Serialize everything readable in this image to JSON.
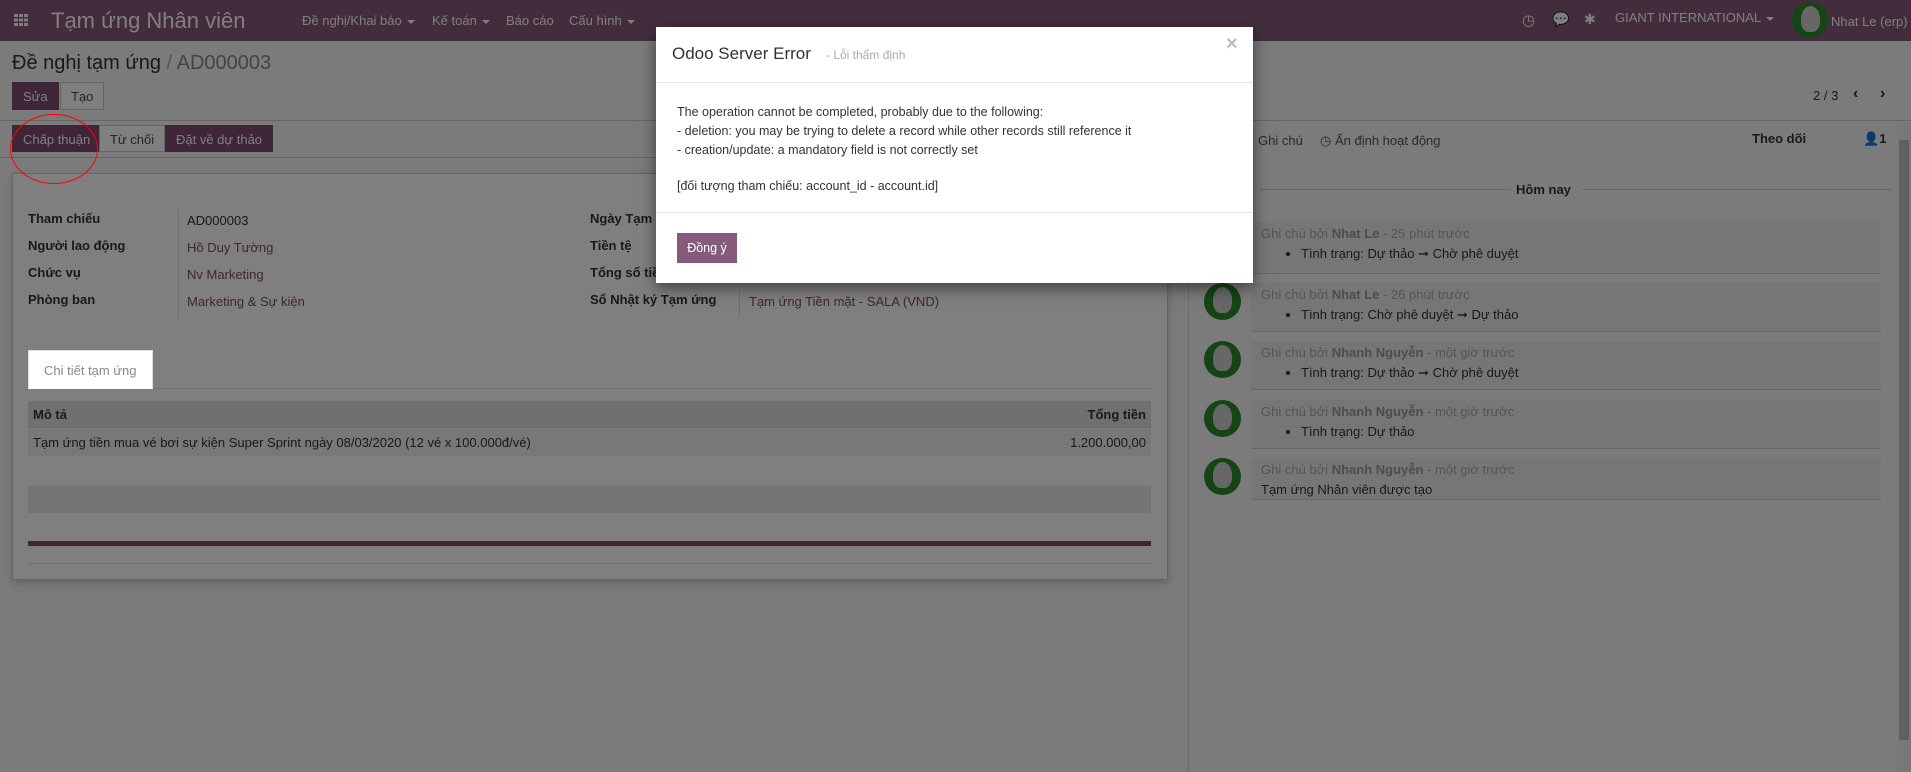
{
  "navbar": {
    "app_title": "Tạm ứng Nhân viên",
    "menus": [
      "Đề nghị/Khai báo",
      "Kế toán",
      "Báo cáo",
      "Cấu hình"
    ],
    "company": "GIANT INTERNATIONAL",
    "user": "Nhat Le (erp)"
  },
  "breadcrumb": {
    "parent": "Đề nghị tạm ứng",
    "separator": "/",
    "current": "AD000003"
  },
  "control": {
    "edit": "Sửa",
    "create": "Tạo",
    "pager": "2 / 3"
  },
  "statusbar": {
    "approve": "Chấp thuận",
    "reject": "Từ chối",
    "reset": "Đặt về dự thảo"
  },
  "form": {
    "left": [
      {
        "label": "Tham chiếu",
        "value": "AD000003"
      },
      {
        "label": "Người lao động",
        "value": "Hồ Duy Tường"
      },
      {
        "label": "Chức vụ",
        "value": "Nv Marketing"
      },
      {
        "label": "Phòng ban",
        "value": "Marketing & Sự kiện"
      }
    ],
    "right": [
      {
        "label": "Ngày Tạm"
      },
      {
        "label": "Tiền tệ"
      },
      {
        "label": "Tổng số tiề"
      },
      {
        "label": "Sổ Nhật ký Tạm ứng",
        "value": "Tạm ứng Tiền mặt - SALA (VND)"
      }
    ],
    "tab": "Chi tiết tạm ứng",
    "table": {
      "headers": [
        "Mô tả",
        "Tổng tiền"
      ],
      "rows": [
        [
          "Tạm ứng tiền mua vé bơi sự kiện Super Sprint ngày 08/03/2020 (12 vé x 100.000đ/vé)",
          "1.200.000,00"
        ]
      ]
    }
  },
  "chatter": {
    "log_note": "Ghi chú",
    "schedule": "Ấn định hoạt động",
    "follow": "Theo dõi",
    "followers": "1",
    "date_sep": "Hôm nay",
    "messages": [
      {
        "prefix": "Ghi chú bởi",
        "author": "Nhat Le",
        "time": "- 25 phút trước",
        "bullet": "Tình trạng: Dự thảo ➞ Chờ phê duyệt"
      },
      {
        "prefix": "Ghi chú bởi",
        "author": "Nhat Le",
        "time": "- 26 phút trước",
        "bullet": "Tình trạng: Chờ phê duyệt ➞ Dự thảo"
      },
      {
        "prefix": "Ghi chú bởi",
        "author": "Nhanh Nguyễn",
        "time": "- một giờ trước",
        "bullet": "Tình trạng: Dự thảo ➞ Chờ phê duyệt"
      },
      {
        "prefix": "Ghi chú bởi",
        "author": "Nhanh Nguyễn",
        "time": "- một giờ trước",
        "bullet": "Tình trạng: Dự thảo"
      },
      {
        "prefix": "Ghi chú bởi",
        "author": "Nhanh Nguyễn",
        "time": "- một giờ trước",
        "body": "Tạm ứng Nhân viên được tạo"
      }
    ]
  },
  "modal": {
    "title": "Odoo Server Error",
    "subtitle": "- Lỗi thẩm định",
    "close": "×",
    "lines": [
      "The operation cannot be completed, probably due to the following:",
      "- deletion: you may be trying to delete a record while other records still reference it",
      "- creation/update: a mandatory field is not correctly set"
    ],
    "reference": "[đối tượng tham chiếu: account_id - account.id]",
    "ok": "Đồng ý"
  },
  "colors": {
    "brand": "#875a7b",
    "annotation": "#ff0000"
  }
}
